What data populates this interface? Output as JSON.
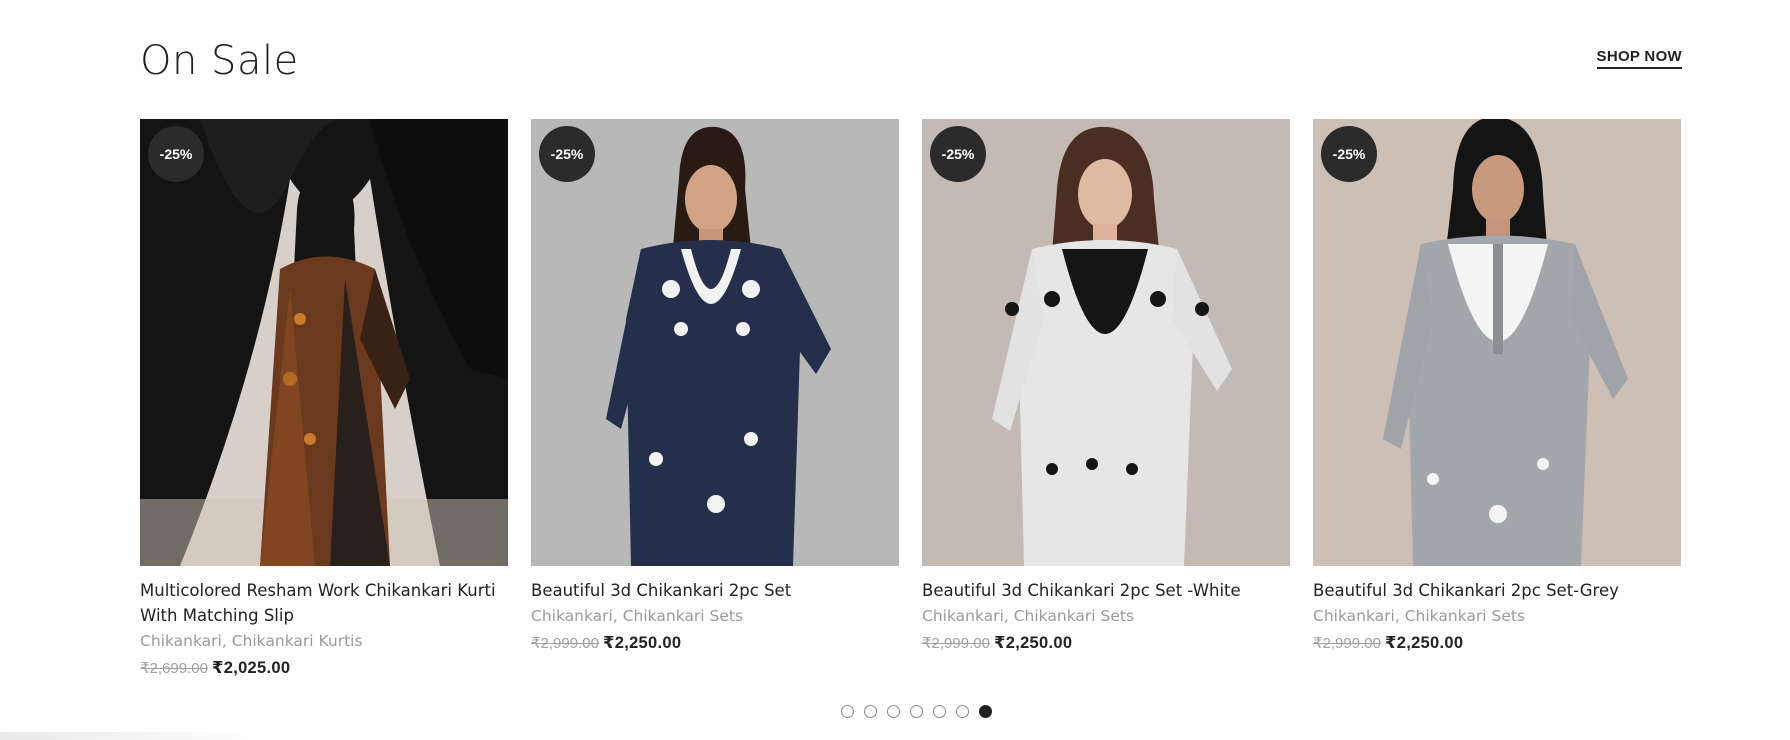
{
  "section": {
    "title": "On Sale",
    "shop_now": "SHOP NOW"
  },
  "products": [
    {
      "badge": "-25%",
      "name": "Multicolored Resham Work Chikankari Kurti With Matching Slip",
      "categories": [
        "Chikankari",
        "Chikankari Kurtis"
      ],
      "old_price": "₹2,699.00",
      "new_price": "₹2,025.00",
      "image": "woman in multicolored resham chikankari kurti"
    },
    {
      "badge": "-25%",
      "name": "Beautiful 3d Chikankari 2pc Set",
      "categories": [
        "Chikankari",
        "Chikankari Sets"
      ],
      "old_price": "₹2,999.00",
      "new_price": "₹2,250.00",
      "image": "woman in navy kurta with white embroidery"
    },
    {
      "badge": "-25%",
      "name": "Beautiful 3d Chikankari 2pc Set -White",
      "categories": [
        "Chikankari",
        "Chikankari Sets"
      ],
      "old_price": "₹2,999.00",
      "new_price": "₹2,250.00",
      "image": "woman in white kurta with black embroidery"
    },
    {
      "badge": "-25%",
      "name": "Beautiful 3d Chikankari 2pc Set-Grey",
      "categories": [
        "Chikankari",
        "Chikankari Sets"
      ],
      "old_price": "₹2,999.00",
      "new_price": "₹2,250.00",
      "image": "woman in grey kurta with white embroidery"
    }
  ],
  "pagination": {
    "total": 7,
    "active": 7
  },
  "colors": {
    "badge": "#2b2b2b",
    "text": "#222222",
    "muted": "#9a9a9a"
  }
}
